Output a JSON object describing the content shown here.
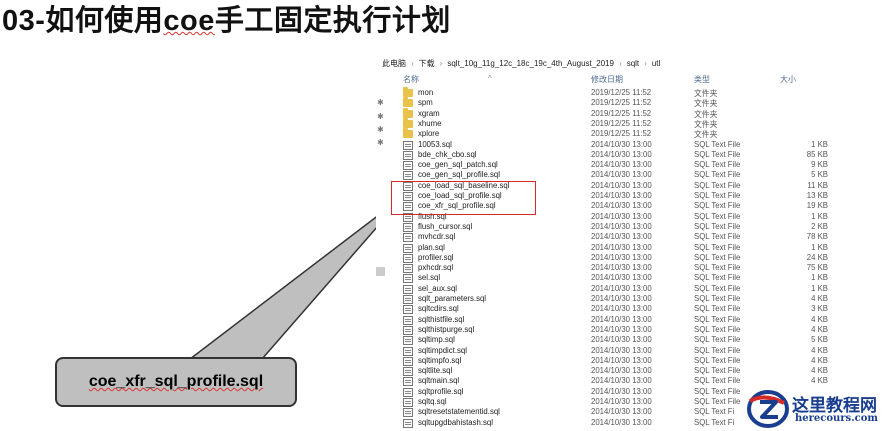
{
  "slide": {
    "title_prefix": "03-如何使用",
    "title_coe": "coe",
    "title_suffix": "手工固定执行计划"
  },
  "breadcrumb": [
    "此电脑",
    "下载",
    "sqlt_10g_11g_12c_18c_19c_4th_August_2019",
    "sqlt",
    "utl"
  ],
  "columns": {
    "name": "名称",
    "date": "修改日期",
    "type": "类型",
    "size": "大小"
  },
  "files": [
    {
      "name": "mon",
      "date": "2019/12/25 11:52",
      "type": "文件夹",
      "size": "",
      "kind": "folder"
    },
    {
      "name": "spm",
      "date": "2019/12/25 11:52",
      "type": "文件夹",
      "size": "",
      "kind": "folder"
    },
    {
      "name": "xgram",
      "date": "2019/12/25 11:52",
      "type": "文件夹",
      "size": "",
      "kind": "folder"
    },
    {
      "name": "xhume",
      "date": "2019/12/25 11:52",
      "type": "文件夹",
      "size": "",
      "kind": "folder"
    },
    {
      "name": "xplore",
      "date": "2019/12/25 11:52",
      "type": "文件夹",
      "size": "",
      "kind": "folder"
    },
    {
      "name": "10053.sql",
      "date": "2014/10/30 13:00",
      "type": "SQL Text File",
      "size": "1 KB",
      "kind": "file"
    },
    {
      "name": "bde_chk_cbo.sql",
      "date": "2014/10/30 13:00",
      "type": "SQL Text File",
      "size": "85 KB",
      "kind": "file"
    },
    {
      "name": "coe_gen_sql_patch.sql",
      "date": "2014/10/30 13:00",
      "type": "SQL Text File",
      "size": "9 KB",
      "kind": "file"
    },
    {
      "name": "coe_gen_sql_profile.sql",
      "date": "2014/10/30 13:00",
      "type": "SQL Text File",
      "size": "5 KB",
      "kind": "file"
    },
    {
      "name": "coe_load_sql_baseline.sql",
      "date": "2014/10/30 13:00",
      "type": "SQL Text File",
      "size": "11 KB",
      "kind": "file"
    },
    {
      "name": "coe_load_sql_profile.sql",
      "date": "2014/10/30 13:00",
      "type": "SQL Text File",
      "size": "13 KB",
      "kind": "file"
    },
    {
      "name": "coe_xfr_sql_profile.sql",
      "date": "2014/10/30 13:00",
      "type": "SQL Text File",
      "size": "19 KB",
      "kind": "file"
    },
    {
      "name": "flush.sql",
      "date": "2014/10/30 13:00",
      "type": "SQL Text File",
      "size": "1 KB",
      "kind": "file"
    },
    {
      "name": "flush_cursor.sql",
      "date": "2014/10/30 13:00",
      "type": "SQL Text File",
      "size": "2 KB",
      "kind": "file"
    },
    {
      "name": "mvhcdr.sql",
      "date": "2014/10/30 13:00",
      "type": "SQL Text File",
      "size": "78 KB",
      "kind": "file"
    },
    {
      "name": "plan.sql",
      "date": "2014/10/30 13:00",
      "type": "SQL Text File",
      "size": "1 KB",
      "kind": "file"
    },
    {
      "name": "profiler.sql",
      "date": "2014/10/30 13:00",
      "type": "SQL Text File",
      "size": "24 KB",
      "kind": "file"
    },
    {
      "name": "pxhcdr.sql",
      "date": "2014/10/30 13:00",
      "type": "SQL Text File",
      "size": "75 KB",
      "kind": "file"
    },
    {
      "name": "sel.sql",
      "date": "2014/10/30 13:00",
      "type": "SQL Text File",
      "size": "1 KB",
      "kind": "file"
    },
    {
      "name": "sel_aux.sql",
      "date": "2014/10/30 13:00",
      "type": "SQL Text File",
      "size": "1 KB",
      "kind": "file"
    },
    {
      "name": "sqlt_parameters.sql",
      "date": "2014/10/30 13:00",
      "type": "SQL Text File",
      "size": "4 KB",
      "kind": "file"
    },
    {
      "name": "sqltcdirs.sql",
      "date": "2014/10/30 13:00",
      "type": "SQL Text File",
      "size": "3 KB",
      "kind": "file"
    },
    {
      "name": "sqlthistfile.sql",
      "date": "2014/10/30 13:00",
      "type": "SQL Text File",
      "size": "4 KB",
      "kind": "file"
    },
    {
      "name": "sqlthistpurge.sql",
      "date": "2014/10/30 13:00",
      "type": "SQL Text File",
      "size": "4 KB",
      "kind": "file"
    },
    {
      "name": "sqltimp.sql",
      "date": "2014/10/30 13:00",
      "type": "SQL Text File",
      "size": "5 KB",
      "kind": "file"
    },
    {
      "name": "sqltimpdict.sql",
      "date": "2014/10/30 13:00",
      "type": "SQL Text File",
      "size": "4 KB",
      "kind": "file"
    },
    {
      "name": "sqltimpfo.sql",
      "date": "2014/10/30 13:00",
      "type": "SQL Text File",
      "size": "4 KB",
      "kind": "file"
    },
    {
      "name": "sqltlite.sql",
      "date": "2014/10/30 13:00",
      "type": "SQL Text File",
      "size": "4 KB",
      "kind": "file"
    },
    {
      "name": "sqltmain.sql",
      "date": "2014/10/30 13:00",
      "type": "SQL Text File",
      "size": "4 KB",
      "kind": "file"
    },
    {
      "name": "sqltprofile.sql",
      "date": "2014/10/30 13:00",
      "type": "SQL Text File",
      "size": "",
      "kind": "file"
    },
    {
      "name": "sqltq.sql",
      "date": "2014/10/30 13:00",
      "type": "SQL Text File",
      "size": "",
      "kind": "file"
    },
    {
      "name": "sqltresetstatementid.sql",
      "date": "2014/10/30 13:00",
      "type": "SQL Text Fi",
      "size": "",
      "kind": "file"
    },
    {
      "name": "sqltupgdbahistash.sql",
      "date": "2014/10/30 13:00",
      "type": "SQL Text Fi",
      "size": "",
      "kind": "file"
    }
  ],
  "callout": {
    "label": "coe_xfr_sql_profile.sql"
  },
  "watermark": {
    "site_cn": "这里教程网",
    "url": "herecours.com"
  }
}
